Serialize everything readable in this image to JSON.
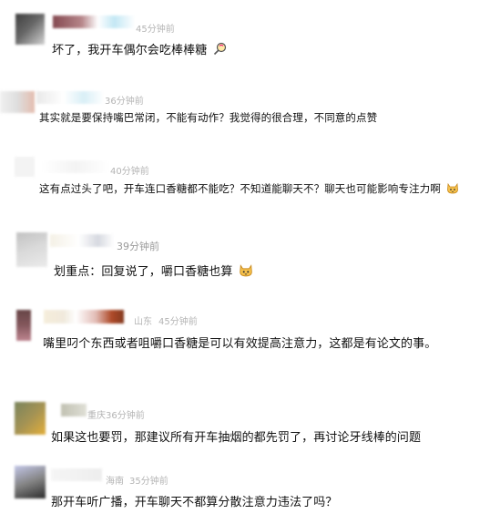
{
  "comments": [
    {
      "meta": "45分钟前",
      "text": "坏了，我开车偶尔会吃棒棒糖",
      "emoji": "lollipop-icon"
    },
    {
      "meta": "36分钟前",
      "text": "其实就是要保持嘴巴常闭，不能有动作？我觉得的很合理，不同意的点赞"
    },
    {
      "meta": "40分钟前",
      "text": "这有点过头了吧，开车连口香糖都不能吃？不知道能聊天不？聊天也可能影响专注力啊",
      "emoji": "cat-face-icon"
    },
    {
      "meta": "39分钟前",
      "text": "划重点：回复说了，嚼口香糖也算",
      "emoji": "cat-face-icon"
    },
    {
      "location": "山东",
      "meta": "45分钟前",
      "text": "嘴里叼个东西或者咀嚼口香糖是可以有效提高注意力，这都是有论文的事。"
    },
    {
      "location": "重庆",
      "meta": "36分钟前",
      "text": "如果这也要罚，那建议所有开车抽烟的都先罚了，再讨论牙线棒的问题"
    },
    {
      "location": "海南",
      "meta": "35分钟前",
      "text": "那开车听广播，开车聊天不都算分散注意力违法了吗？"
    }
  ]
}
